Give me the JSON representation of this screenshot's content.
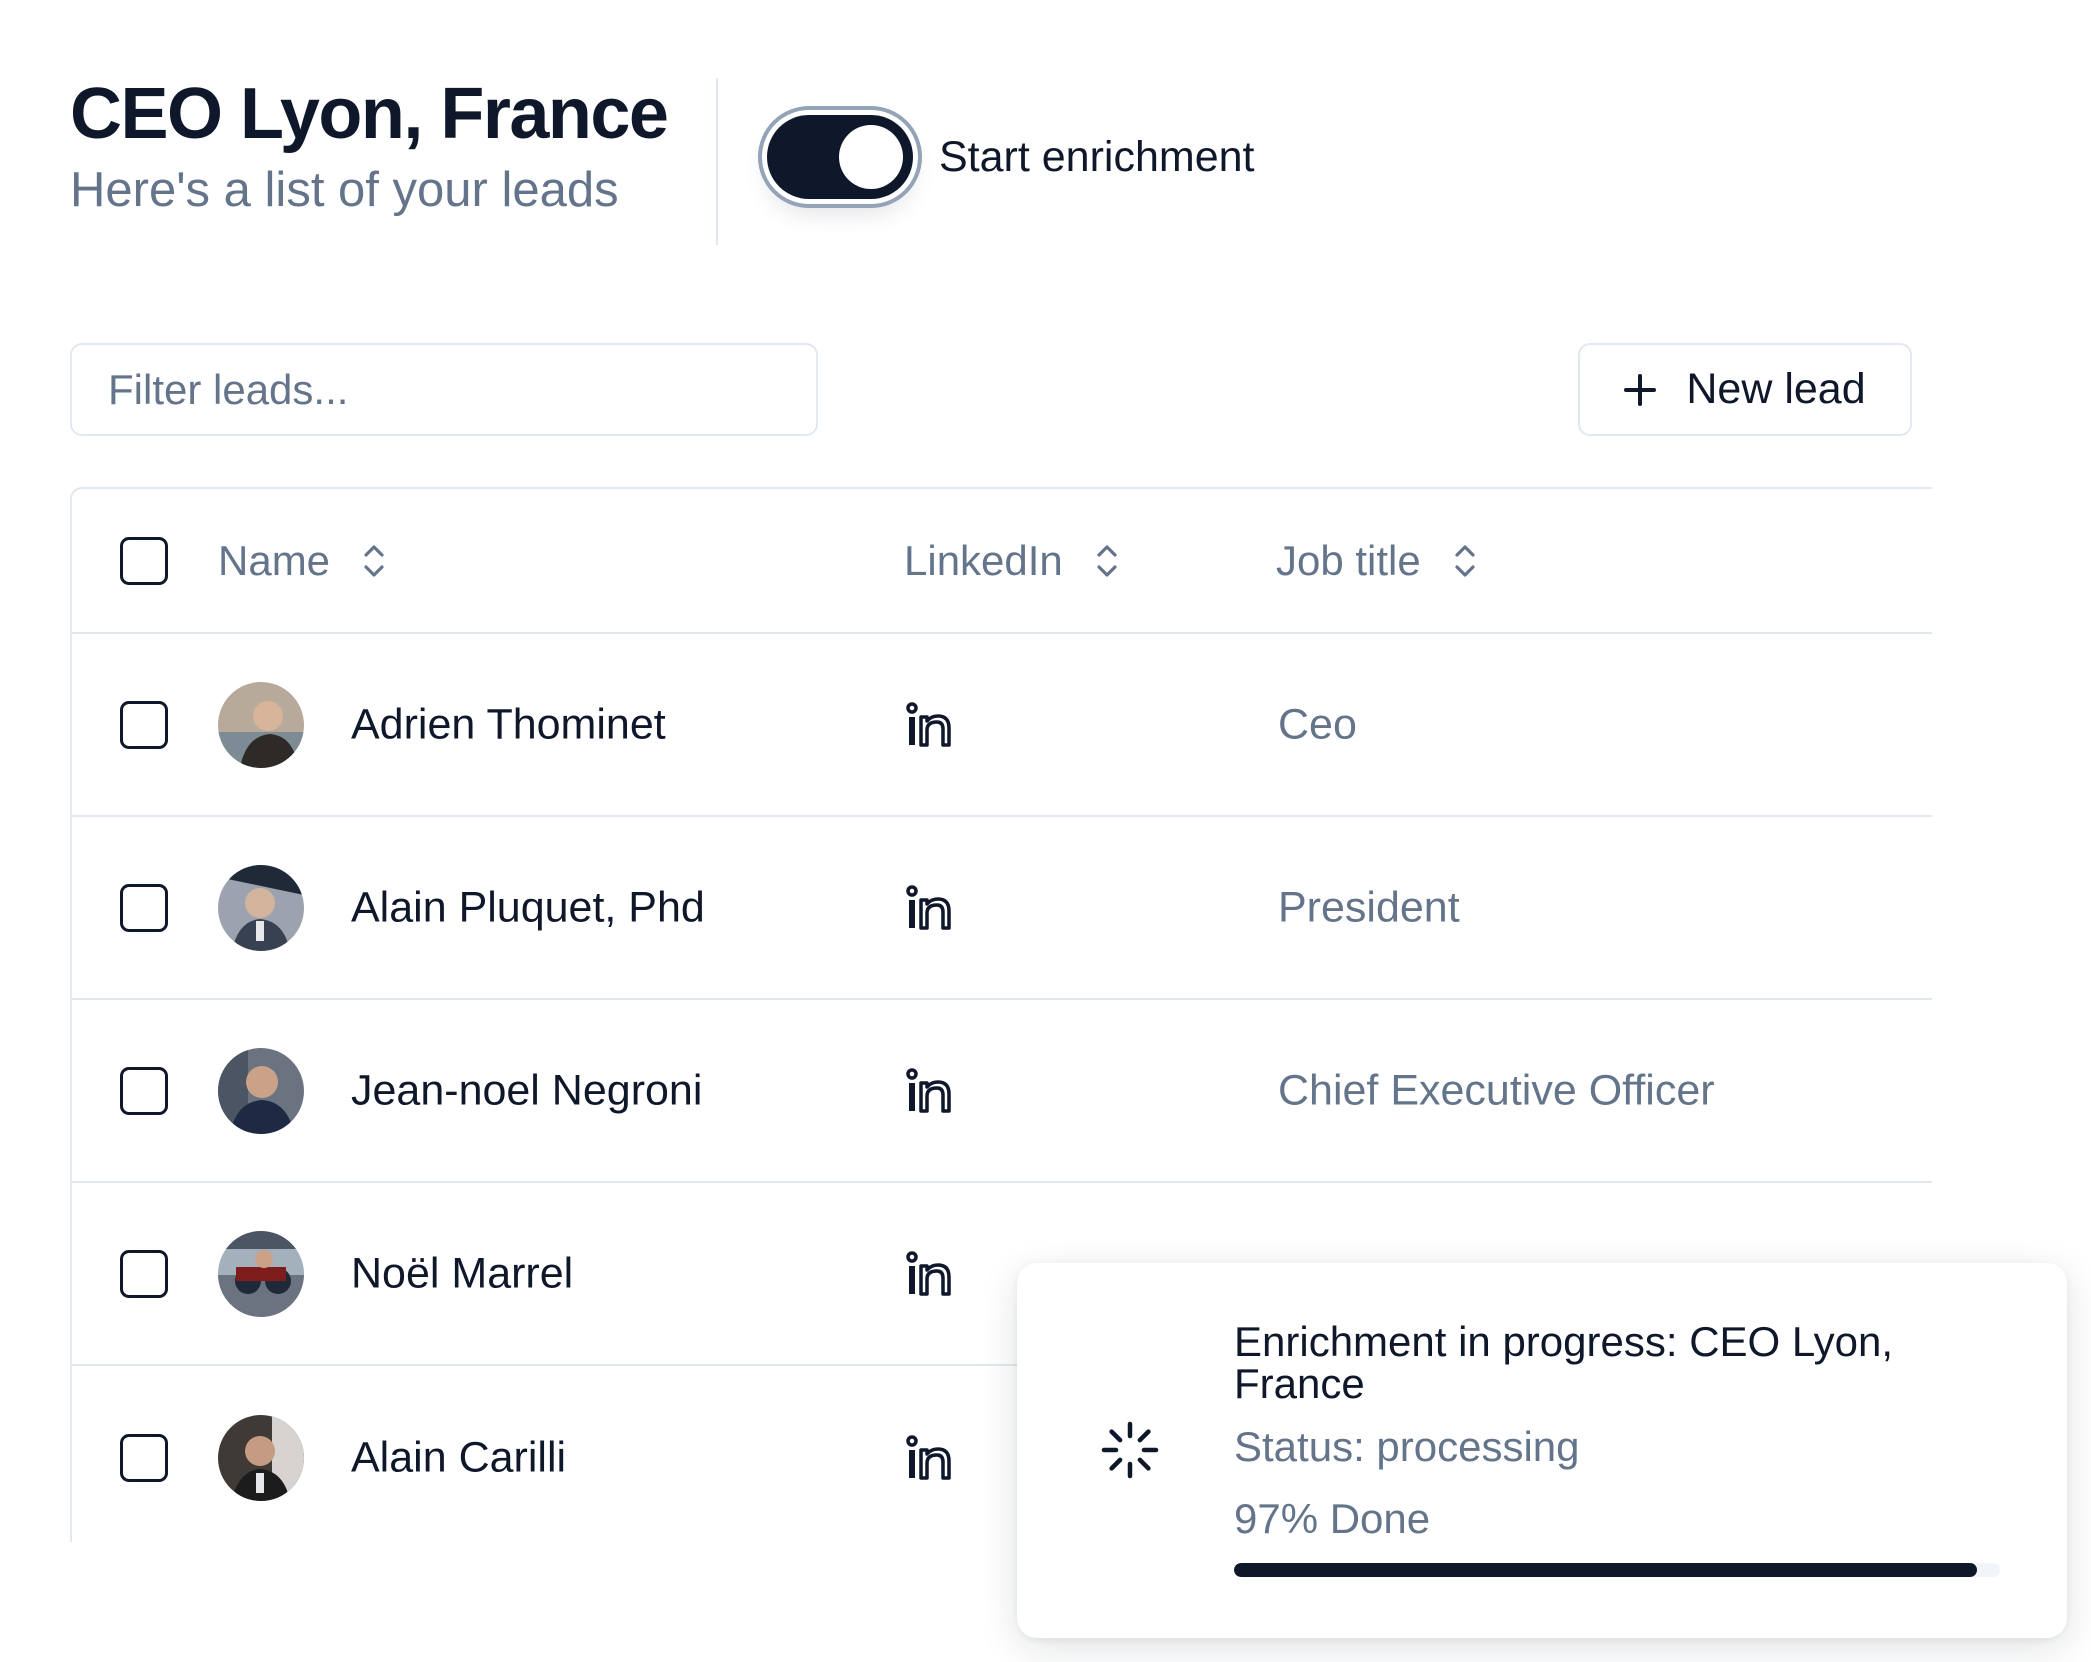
{
  "header": {
    "title": "CEO Lyon, France",
    "subtitle": "Here's a list of your leads",
    "toggle": {
      "label": "Start enrichment",
      "on": true
    }
  },
  "toolbar": {
    "filter_placeholder": "Filter leads...",
    "filter_value": "",
    "new_lead_label": "New lead"
  },
  "table": {
    "columns": [
      {
        "label": "Name"
      },
      {
        "label": "LinkedIn"
      },
      {
        "label": "Job title"
      }
    ],
    "rows": [
      {
        "name": "Adrien Thominet",
        "job_title": "Ceo",
        "avatar": {
          "bg": "#9c8f82",
          "fg": "#3b2f2a"
        }
      },
      {
        "name": "Alain Pluquet, Phd",
        "job_title": "President",
        "avatar": {
          "bg": "#6b7280",
          "fg": "#1f2937"
        }
      },
      {
        "name": "Jean-noel Negroni",
        "job_title": "Chief Executive Officer",
        "avatar": {
          "bg": "#4b5563",
          "fg": "#1e2a44"
        }
      },
      {
        "name": "Noël Marrel",
        "job_title": "",
        "avatar": {
          "bg": "#7b8794",
          "fg": "#2d2d2d"
        }
      },
      {
        "name": "Alain Carilli",
        "job_title": "",
        "avatar": {
          "bg": "#3f3a36",
          "fg": "#1c1c1c"
        }
      }
    ]
  },
  "toast": {
    "title": "Enrichment in progress: CEO Lyon, France",
    "status": "Status: processing",
    "progress_text": "97% Done",
    "progress": 0.97
  },
  "icons": {
    "toggle": "toggle-switch",
    "new_lead": "plus-icon",
    "sort": "chevrons-up-down-icon",
    "linkedin": "linkedin-icon",
    "spinner": "loader-icon"
  },
  "colors": {
    "primary": "#0f172a",
    "muted_text": "#64748b",
    "border": "#e2e8f0"
  }
}
